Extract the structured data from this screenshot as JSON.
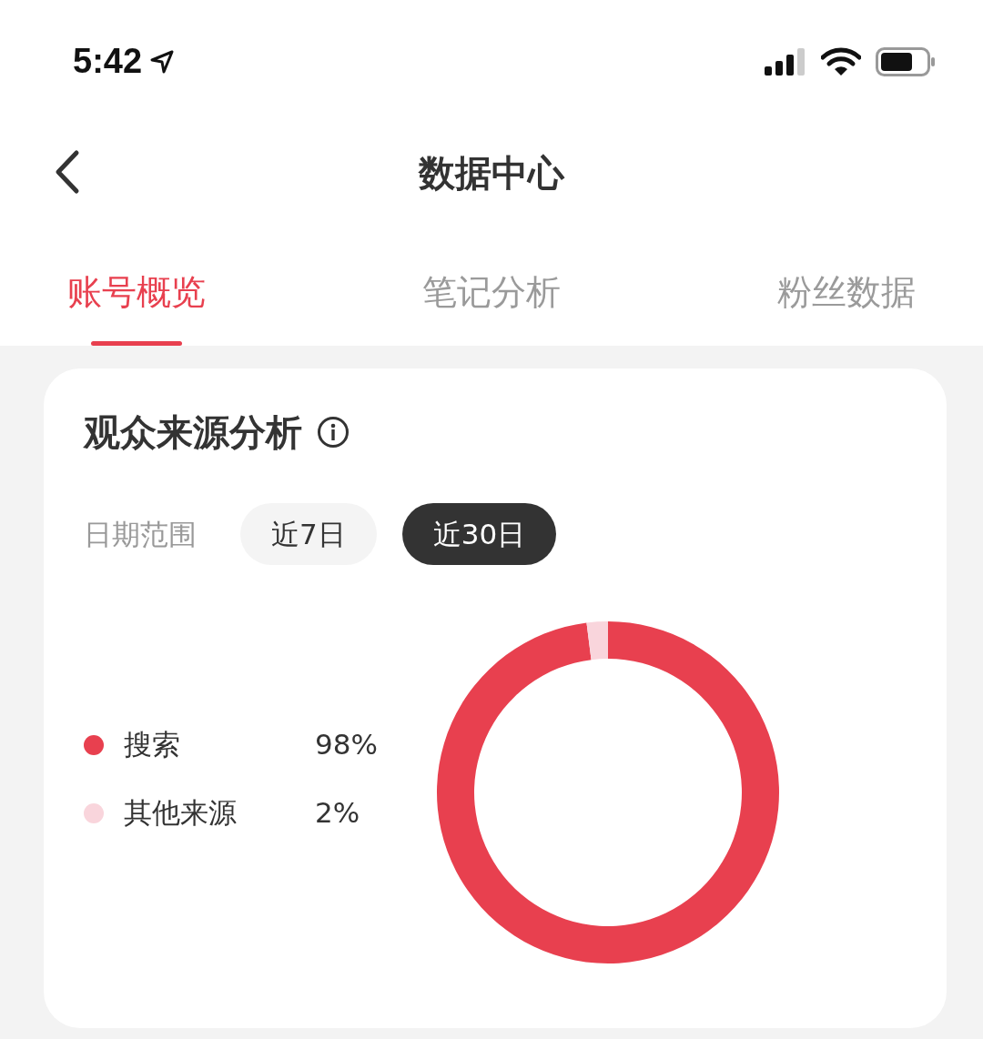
{
  "status_bar": {
    "time": "5:42"
  },
  "header": {
    "title": "数据中心"
  },
  "tabs": [
    {
      "label": "账号概览",
      "selected": true
    },
    {
      "label": "笔记分析",
      "selected": false
    },
    {
      "label": "粉丝数据",
      "selected": false
    }
  ],
  "card": {
    "title": "观众来源分析",
    "date_range_label": "日期范围",
    "ranges": [
      {
        "label": "近7日",
        "selected": false
      },
      {
        "label": "近30日",
        "selected": true
      }
    ],
    "legend": [
      {
        "value": "98%",
        "color": "#e8404f"
      },
      {
        "value": "2%",
        "color": "#f9d5dc"
      }
    ],
    "chart_data": {
      "type": "donut",
      "categories": [
        "搜索",
        "其他来源"
      ],
      "values": [
        98,
        2
      ]
    }
  }
}
